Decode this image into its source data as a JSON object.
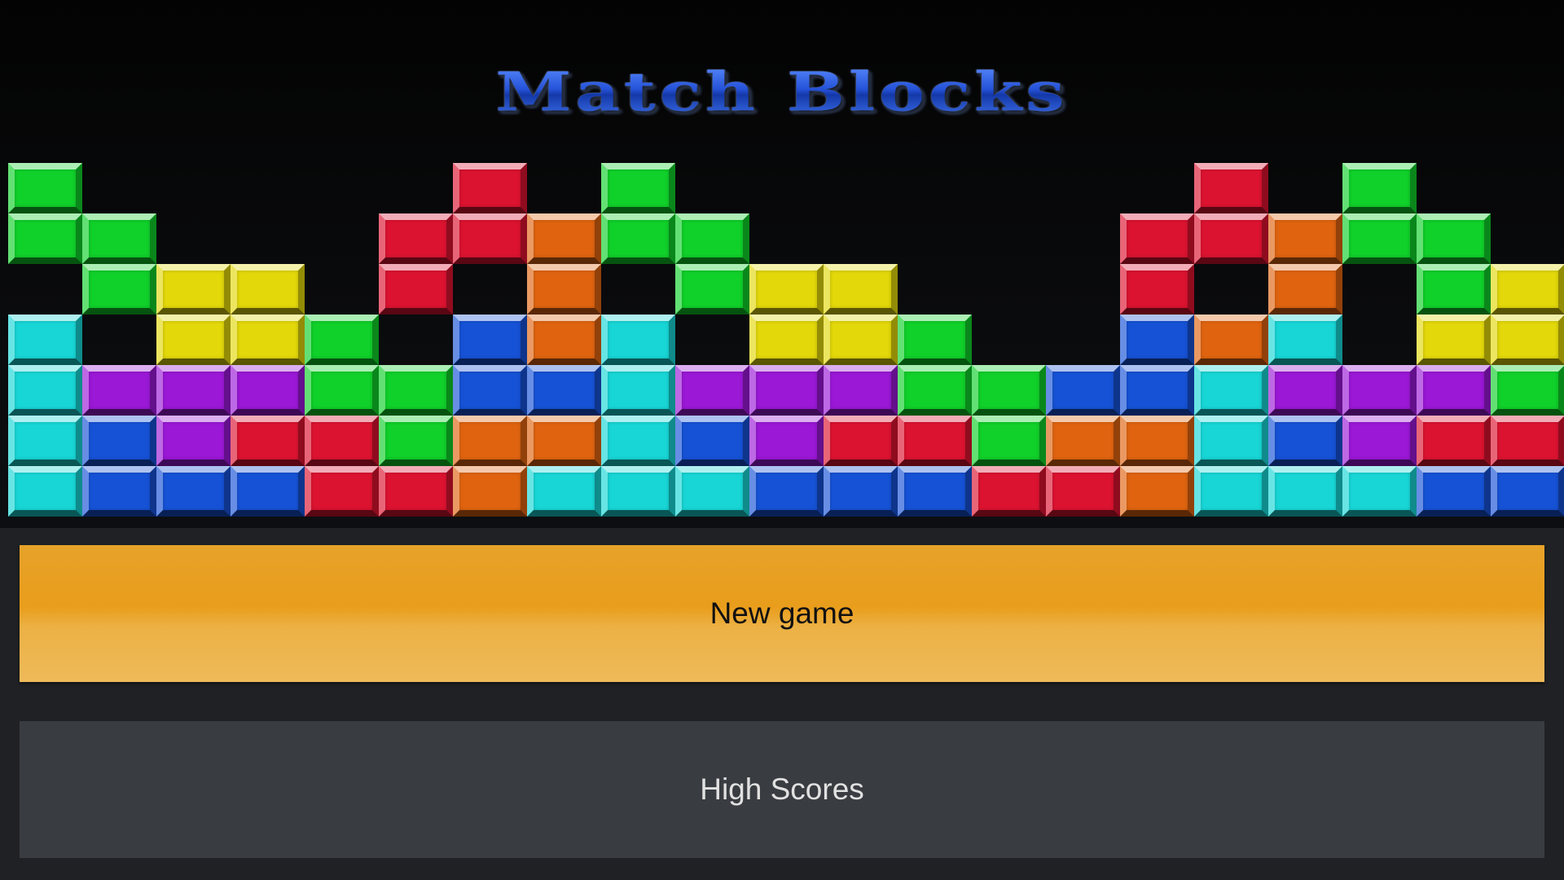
{
  "title": "Match Blocks",
  "colors": {
    "background": "#1f2124",
    "banner": "#0a0b0d",
    "title": "#2552d8",
    "new_game_button": "#e99d1b",
    "high_scores_button": "#393c40",
    "block_palette": {
      "g": "#10d02a",
      "r": "#dc1330",
      "o": "#e06410",
      "y": "#e2d80a",
      "c": "#18d6d6",
      "b": "#1652d6",
      "p": "#9a18d6"
    }
  },
  "blocks": {
    "rows": [
      "g.....r.g.......r.g....",
      "gg...rrogg.....rrogg...",
      ".gyy.r.o.gyy...r.o.gyy.",
      "c.yyg.boc.yyg..boc.yyg",
      "cpppggbbcpppggbbcpppg",
      "cbprrgoocbprrgoocbprrr",
      "cbbbrrocccbbbrrocccbbr"
    ]
  },
  "menu": {
    "new_game": "New game",
    "high_scores": "High Scores"
  }
}
